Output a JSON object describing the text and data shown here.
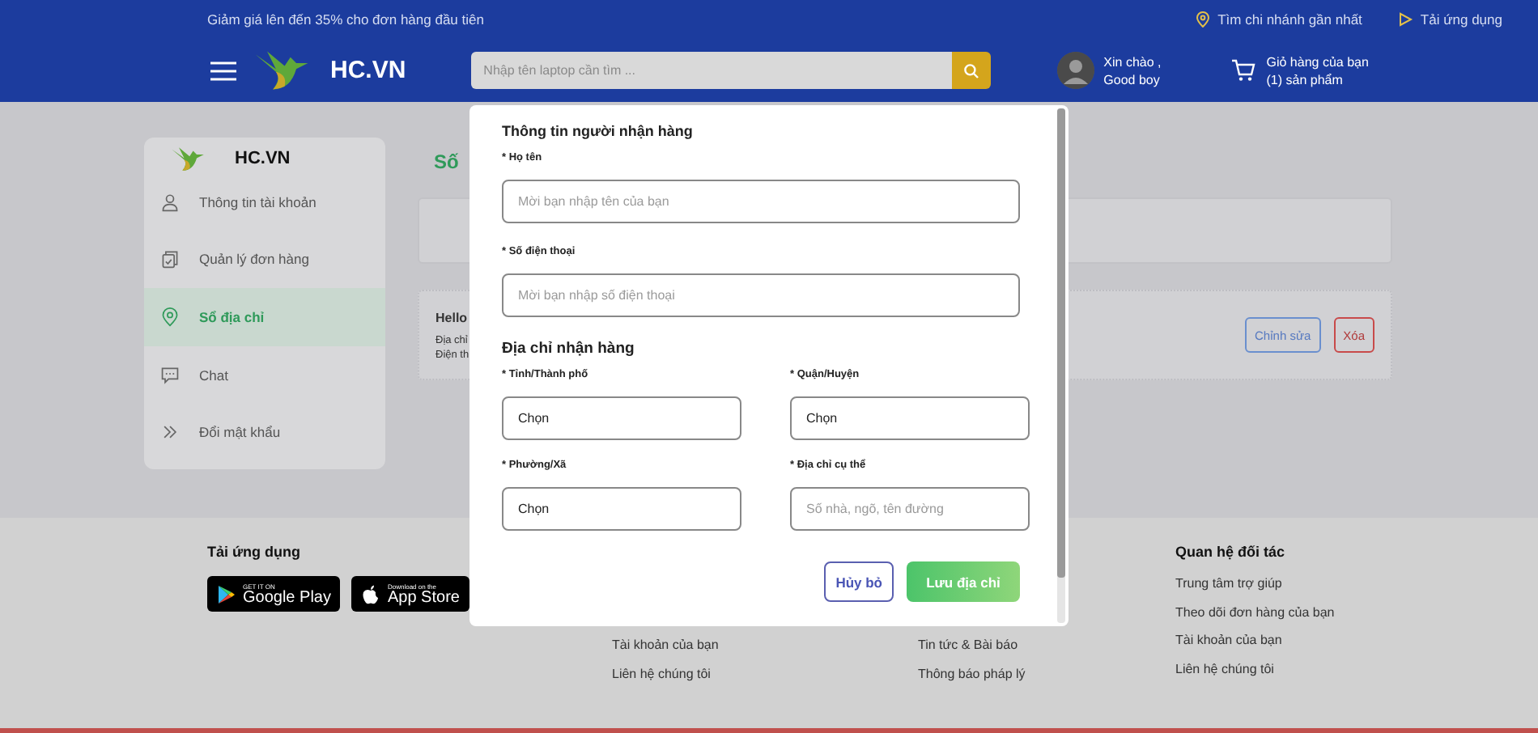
{
  "top_bar": {
    "promo": "Giảm giá lên đến 35% cho đơn hàng đầu tiên",
    "links": [
      {
        "kind": "location",
        "label": "Tìm chi nhánh gần nhất"
      },
      {
        "kind": "app",
        "label": "Tải ứng dụng"
      }
    ]
  },
  "header": {
    "logo": "HC.VN",
    "search": {
      "placeholder": "Nhập tên laptop cần tìm ..."
    },
    "user": {
      "greeting": "Xin chào ,",
      "name": "Good boy"
    },
    "cart": {
      "label": "Giỏ hàng của bạn",
      "count": "(1) sản phẩm"
    }
  },
  "sidebar": {
    "logo": "HC.VN",
    "items": [
      {
        "kind": "user",
        "label": "Thông tin tài khoản",
        "selected": false
      },
      {
        "kind": "orders",
        "label": "Quản lý đơn hàng",
        "selected": false
      },
      {
        "kind": "location",
        "label": "Sổ địa chỉ",
        "selected": true
      },
      {
        "kind": "chat",
        "label": "Chat",
        "selected": false
      },
      {
        "kind": "chevrons",
        "label": "Đổi mật khẩu",
        "selected": false
      }
    ]
  },
  "main": {
    "title": "Số",
    "address_card": {
      "name": "Hello",
      "lines": [
        "Địa chỉ",
        "Điện th"
      ],
      "actions": [
        {
          "kind": "edit",
          "label": "Chỉnh sửa"
        },
        {
          "kind": "delete",
          "label": "Xóa"
        }
      ]
    }
  },
  "footer": {
    "columns": [
      {
        "title": "Tải ứng dụng",
        "stores": [
          {
            "kind": "google",
            "small": "GET IT ON",
            "name": "Google Play"
          },
          {
            "kind": "apple",
            "small": "Download on the",
            "name": "App Store"
          }
        ]
      },
      {
        "links": [
          "Tài khoản của bạn",
          "Liên hệ chúng tôi"
        ]
      },
      {
        "links": [
          "Tin tức & Bài báo",
          "Thông báo pháp lý"
        ]
      },
      {
        "title": "Quan hệ đối tác",
        "links": [
          "Trung tâm trợ giúp",
          "Theo dõi đơn hàng của bạn",
          "Tài khoản của bạn",
          "Liên hệ chúng tôi"
        ]
      }
    ]
  },
  "modal": {
    "sections": [
      {
        "title": "Thông tin người nhận hàng",
        "kind": "single",
        "fields": [
          {
            "kind": "text",
            "label": "* Họ tên",
            "placeholder": "Mời bạn nhập tên của bạn"
          },
          {
            "kind": "text",
            "label": "* Số điện thoại",
            "placeholder": "Mời bạn nhập số điện thoại"
          }
        ]
      },
      {
        "title": "Địa chỉ nhận hàng",
        "kind": "pair",
        "fields": [
          {
            "kind": "select",
            "label": "* Tỉnh/Thành phố",
            "value": "Chọn"
          },
          {
            "kind": "select",
            "label": "* Quận/Huyện",
            "value": "Chọn"
          },
          {
            "kind": "select",
            "label": "* Phường/Xã",
            "value": "Chọn"
          },
          {
            "kind": "text",
            "label": "* Địa chỉ cụ thể",
            "placeholder": "Số nhà, ngõ, tên đường"
          }
        ]
      }
    ],
    "buttons": [
      {
        "kind": "secondary",
        "label": "Hủy bỏ"
      },
      {
        "kind": "primary",
        "label": "Lưu địa chỉ"
      }
    ]
  }
}
